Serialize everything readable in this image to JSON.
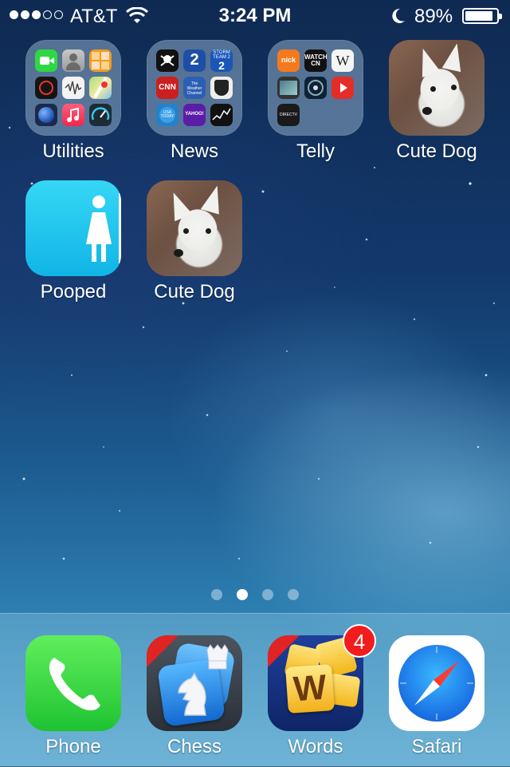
{
  "status_bar": {
    "carrier": "AT&T",
    "signal_bars_filled": 3,
    "signal_bars_total": 5,
    "time": "3:24 PM",
    "battery_percent": "89%",
    "battery_level": 0.89,
    "icons": [
      "wifi-icon",
      "moon-icon",
      "battery-icon"
    ]
  },
  "home_apps": [
    {
      "label": "Utilities",
      "type": "folder"
    },
    {
      "label": "News",
      "type": "folder"
    },
    {
      "label": "Telly",
      "type": "folder"
    },
    {
      "label": "Cute Dog",
      "type": "app"
    },
    {
      "label": "Pooped",
      "type": "app"
    },
    {
      "label": "Cute Dog",
      "type": "app"
    }
  ],
  "folder_minis": {
    "news": [
      "STORM TEAM 2",
      "CNN",
      "The Weather Channel",
      "USA TODAY",
      "YAHOO!"
    ],
    "telly": [
      "nick",
      "WATCH CN",
      "W",
      "DIRECTV"
    ]
  },
  "page_indicator": {
    "count": 4,
    "active_index": 1
  },
  "dock": [
    {
      "label": "Phone"
    },
    {
      "label": "Chess"
    },
    {
      "label": "Words",
      "badge": "4"
    },
    {
      "label": "Safari"
    }
  ],
  "colors": {
    "badge": "#f21c1c",
    "phone_green": "#2fd842",
    "pooped_cyan": "#10b5e6",
    "safari_blue": "#1a8ef0"
  }
}
